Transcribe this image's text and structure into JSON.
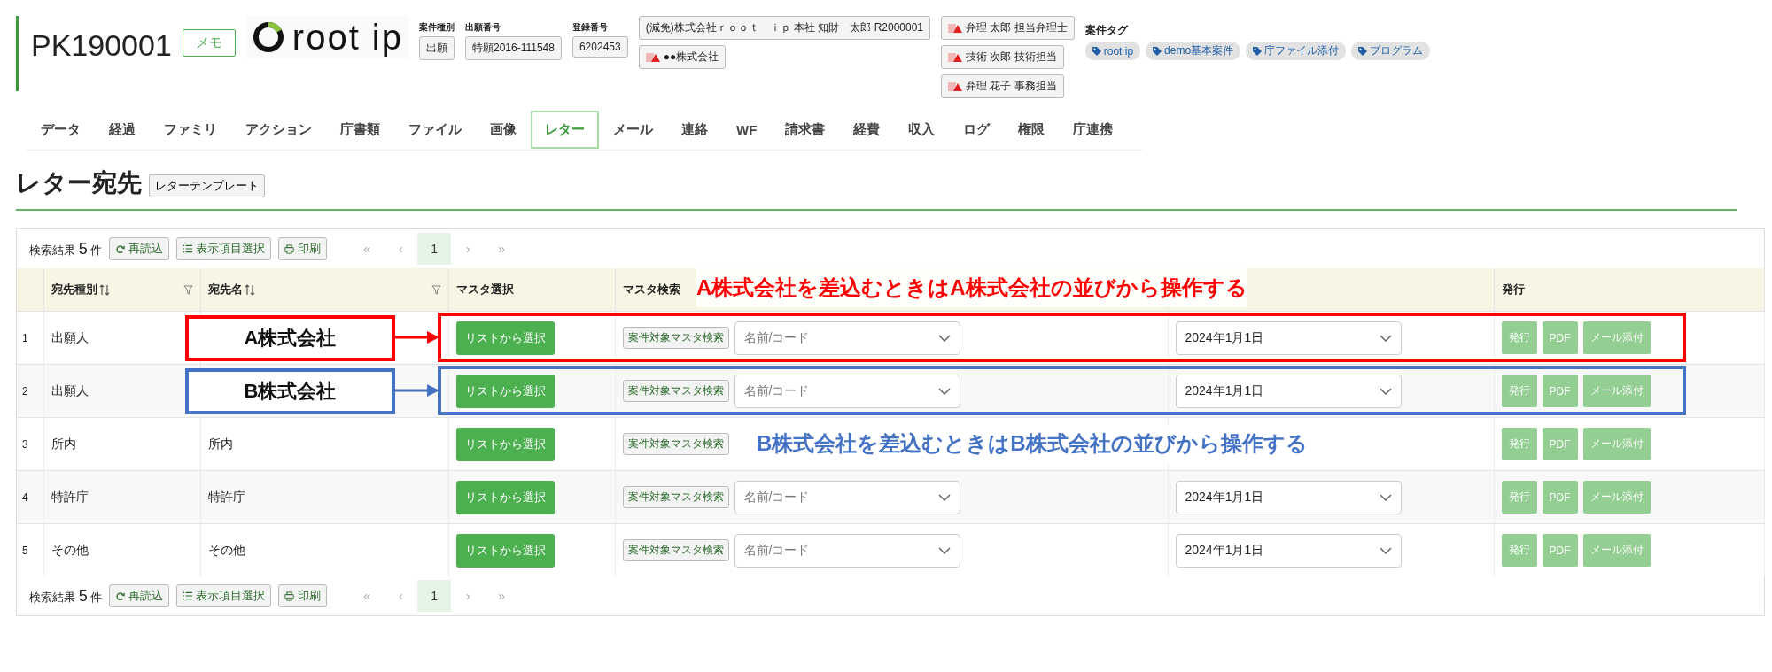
{
  "header": {
    "case_id": "PK190001",
    "memo_button": "メモ",
    "logo_text": "root ip",
    "fields": [
      {
        "label": "案件種別",
        "value": "出願"
      },
      {
        "label": "出願番号",
        "value": "特願2016-111548"
      },
      {
        "label": "登録番号",
        "value": "6202453"
      }
    ],
    "applicants": [
      {
        "text": "(減免)株式会社ｒｏｏｔ　ｉｐ 本社 知財　太郎 R2000001",
        "warning": false
      },
      {
        "text": "●●株式会社",
        "warning": true
      }
    ],
    "staff": [
      {
        "text": "弁理 太郎  担当弁理士",
        "warning": true
      },
      {
        "text": "技術 次郎  技術担当",
        "warning": true
      },
      {
        "text": "弁理 花子  事務担当",
        "warning": true
      }
    ],
    "tags_label": "案件タグ",
    "tags": [
      "root ip",
      "demo基本案件",
      "庁ファイル添付",
      "プログラム"
    ]
  },
  "tabs": [
    {
      "label": "データ",
      "selected": false
    },
    {
      "label": "経過",
      "selected": false
    },
    {
      "label": "ファミリ",
      "selected": false
    },
    {
      "label": "アクション",
      "selected": false
    },
    {
      "label": "庁書類",
      "selected": false
    },
    {
      "label": "ファイル",
      "selected": false
    },
    {
      "label": "画像",
      "selected": false
    },
    {
      "label": "レター",
      "selected": true
    },
    {
      "label": "メール",
      "selected": false
    },
    {
      "label": "連絡",
      "selected": false
    },
    {
      "label": "WF",
      "selected": false
    },
    {
      "label": "請求書",
      "selected": false
    },
    {
      "label": "経費",
      "selected": false
    },
    {
      "label": "収入",
      "selected": false
    },
    {
      "label": "ログ",
      "selected": false
    },
    {
      "label": "権限",
      "selected": false
    },
    {
      "label": "庁連携",
      "selected": false
    }
  ],
  "section": {
    "title": "レター宛先",
    "template_button": "レターテンプレート"
  },
  "toolbar": {
    "result_label": "検索結果",
    "count": "5",
    "unit": "件",
    "reload": "再読込",
    "columns": "表示項目選択",
    "print": "印刷",
    "pager": [
      {
        "label": "«",
        "selected": false
      },
      {
        "label": "‹",
        "selected": false
      },
      {
        "label": "1",
        "selected": true
      },
      {
        "label": "›",
        "selected": false
      },
      {
        "label": "»",
        "selected": false
      }
    ]
  },
  "table": {
    "columns": [
      {
        "label": "宛先種別",
        "sortable": true
      },
      {
        "label": "宛先名",
        "sortable": true
      },
      {
        "label": "マスタ選択",
        "sortable": false
      },
      {
        "label": "マスタ検索",
        "sortable": false
      },
      {
        "label": "発行",
        "sortable": false
      }
    ],
    "rows": [
      {
        "no": "1",
        "type": "出願人",
        "callout": {
          "label": "A株式会社",
          "note_above": "A株式会社を差込むときはA株式会社の並びから操作する",
          "color": "#ff0000"
        },
        "select_button": "リストから選択",
        "search_button": "案件対象マスタ検索",
        "name_placeholder": "名前/コード",
        "date": "2024年1月1日",
        "actions": [
          {
            "label": "発行",
            "disabled": true
          },
          {
            "label": "PDF",
            "disabled": true
          },
          {
            "label": "メール添付",
            "disabled": true
          }
        ]
      },
      {
        "no": "2",
        "type": "出願人",
        "callout": {
          "label": "B株式会社",
          "note_below": "B株式会社を差込むときはB株式会社の並びから操作する",
          "color": "#4472c4"
        },
        "select_button": "リストから選択",
        "search_button": "案件対象マスタ検索",
        "name_placeholder": "名前/コード",
        "date": "2024年1月1日",
        "actions": [
          {
            "label": "発行",
            "disabled": true
          },
          {
            "label": "PDF",
            "disabled": true
          },
          {
            "label": "メール添付",
            "disabled": true
          }
        ]
      },
      {
        "no": "3",
        "type": "所内",
        "name": "所内",
        "select_button": "リストから選択",
        "search_button": "案件対象マスタ検索",
        "actions": [
          {
            "label": "発行",
            "disabled": true
          },
          {
            "label": "PDF",
            "disabled": true
          },
          {
            "label": "メール添付",
            "disabled": true
          }
        ]
      },
      {
        "no": "4",
        "type": "特許庁",
        "name": "特許庁",
        "select_button": "リストから選択",
        "search_button": "案件対象マスタ検索",
        "name_placeholder": "名前/コード",
        "date": "2024年1月1日",
        "actions": [
          {
            "label": "発行",
            "disabled": true
          },
          {
            "label": "PDF",
            "disabled": true
          },
          {
            "label": "メール添付",
            "disabled": true
          }
        ]
      },
      {
        "no": "5",
        "type": "その他",
        "name": "その他",
        "select_button": "リストから選択",
        "search_button": "案件対象マスタ検索",
        "name_placeholder": "名前/コード",
        "date": "2024年1月1日",
        "actions": [
          {
            "label": "発行",
            "disabled": true
          },
          {
            "label": "PDF",
            "disabled": true
          },
          {
            "label": "メール添付",
            "disabled": true
          }
        ]
      }
    ]
  },
  "footer": {
    "result_label": "検索結果",
    "count": "5",
    "unit": "件",
    "reload": "再読込",
    "columns": "表示項目選択",
    "print": "印刷",
    "pager": [
      {
        "label": "«",
        "selected": false
      },
      {
        "label": "‹",
        "selected": false
      },
      {
        "label": "1",
        "selected": true
      },
      {
        "label": "›",
        "selected": false
      },
      {
        "label": "»",
        "selected": false
      }
    ]
  }
}
